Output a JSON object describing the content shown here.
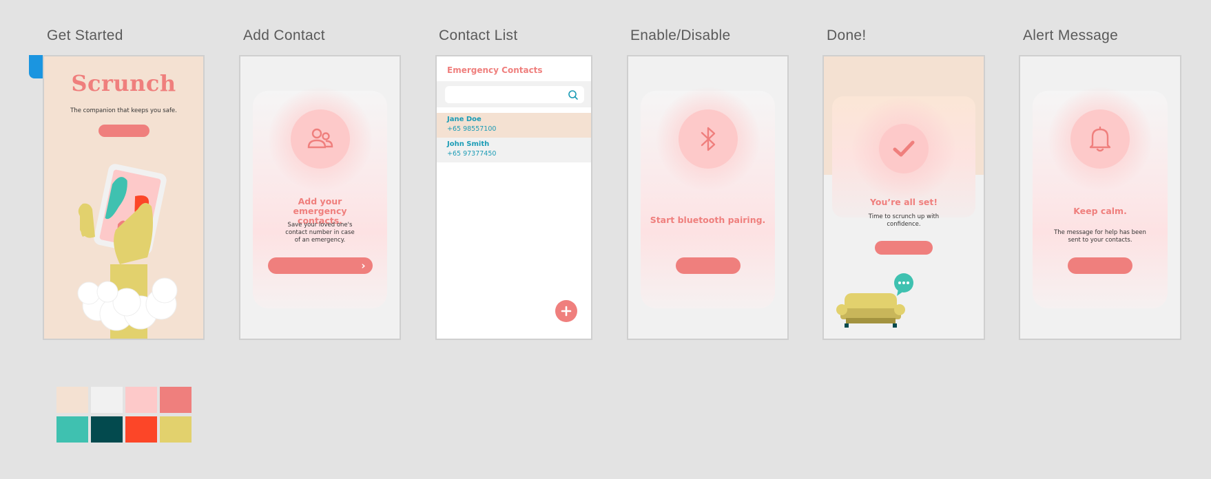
{
  "frames": {
    "get_started": {
      "label": "Get Started"
    },
    "add_contact": {
      "label": "Add Contact"
    },
    "contact_list": {
      "label": "Contact List"
    },
    "enable_disable": {
      "label": "Enable/Disable"
    },
    "done": {
      "label": "Done!"
    },
    "alert_message": {
      "label": "Alert Message"
    }
  },
  "get_started": {
    "logo": "Scrunch",
    "tagline": "The companion that keeps you safe."
  },
  "add_contact": {
    "heading": "Add your emergency contacts.",
    "body": "Save your loved one's contact number in case of an emergency."
  },
  "contact_list": {
    "title": "Emergency Contacts",
    "search_placeholder": "",
    "contacts": [
      {
        "name": "Jane Doe",
        "phone": "+65 98557100"
      },
      {
        "name": "John Smith",
        "phone": "+65 97377450"
      }
    ]
  },
  "enable_disable": {
    "heading": "Start bluetooth pairing."
  },
  "done": {
    "heading": "You’re all set!",
    "body": "Time to scrunch up with confidence."
  },
  "alert_message": {
    "heading": "Keep calm.",
    "body": "The message for help has been sent to your contacts."
  },
  "icons": [
    "users-icon",
    "bluetooth-icon",
    "checkmark-icon",
    "bell-icon",
    "search-icon",
    "plus-icon",
    "chevron-right-icon",
    "chat-bubble-icon",
    "sofa-icon"
  ],
  "palette": [
    "#f4e1d2",
    "#f1f1f1",
    "#fdc9c9",
    "#ef7f7d",
    "#3fc1b0",
    "#034a4e",
    "#fc4628",
    "#e2d16d"
  ],
  "colors": {
    "background": "#e3e3e3",
    "accent": "#ef7f7d",
    "link_blue": "#1a9bb5",
    "selection_blue": "#1b95e0"
  }
}
